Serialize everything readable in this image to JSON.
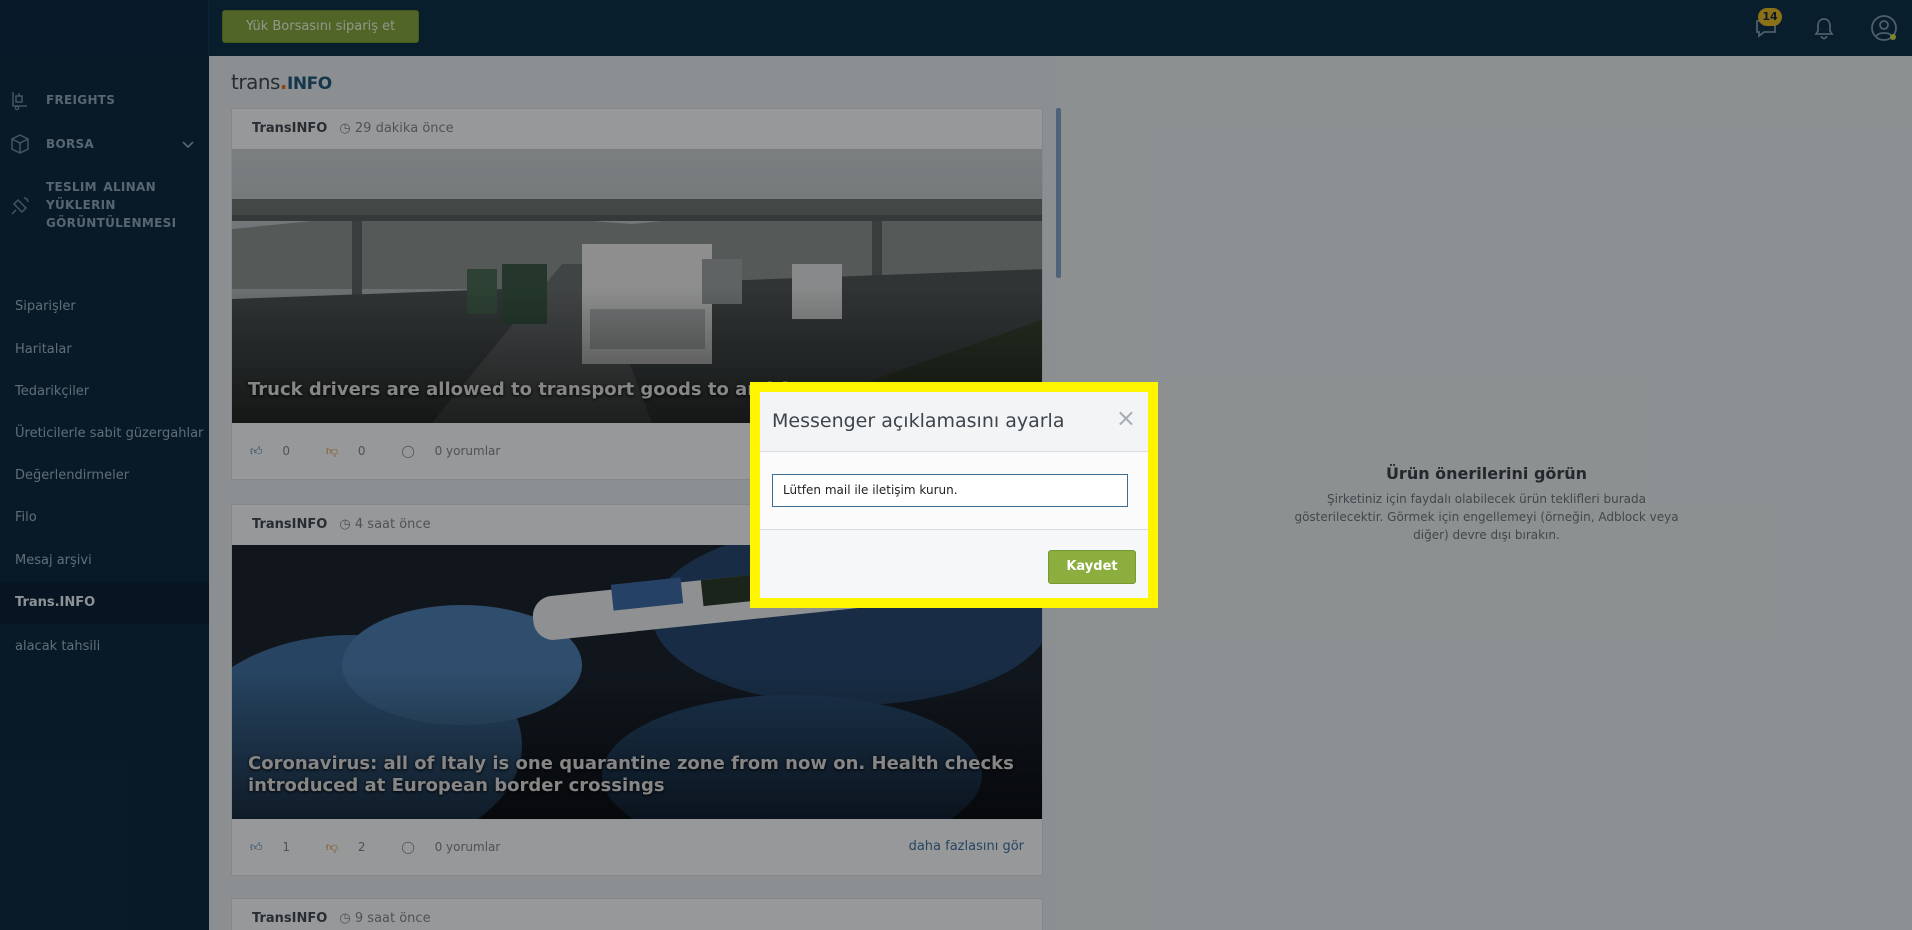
{
  "topbar": {
    "order_label": "Yük Borsasını sipariş et",
    "messages_count": "14",
    "icons": [
      "chat-icon",
      "bell-icon",
      "user-icon"
    ]
  },
  "sidebar": {
    "main": [
      {
        "label": "FREIGHTS",
        "icon": "freight-icon"
      },
      {
        "label": "BORSA",
        "icon": "box-icon"
      },
      {
        "label": "TESLIM ALINAN YÜKLERIN GÖRÜNTÜLENMESI",
        "icon": "satellite-icon"
      }
    ],
    "items": [
      {
        "label": "Siparişler"
      },
      {
        "label": "Haritalar"
      },
      {
        "label": "Tedarikçiler"
      },
      {
        "label": "Üreticilerle sabit güzergahlar"
      },
      {
        "label": "Değerlendirmeler"
      },
      {
        "label": "Filo"
      },
      {
        "label": "Mesaj arşivi"
      },
      {
        "label": "Trans.INFO"
      },
      {
        "label": "alacak tahsili"
      }
    ]
  },
  "news": {
    "logo_trans": "trans",
    "logo_dot": ".",
    "logo_info": "INFO",
    "cards": [
      {
        "source": "TransINFO",
        "time": "29 dakika önce",
        "title": "Truck drivers are allowed to transport goods to and from",
        "likes": "0",
        "dislikes": "0",
        "comments": "0 yorumlar"
      },
      {
        "source": "TransINFO",
        "time": "4 saat önce",
        "title": "Coronavirus: all of Italy is one quarantine zone from now on. Health checks introduced at European border crossings",
        "likes": "1",
        "dislikes": "2",
        "comments": "0 yorumlar",
        "more": "daha fazlasını gör"
      },
      {
        "source": "TransINFO",
        "time": "9 saat önce"
      }
    ]
  },
  "right_panel": {
    "title": "Ürün önerilerini görün",
    "text": "Şirketiniz için faydalı olabilecek ürün teklifleri burada gösterilecektir. Görmek için engellemeyi (örneğin, Adblock veya diğer) devre dışı bırakın."
  },
  "modal": {
    "title": "Messenger açıklamasını ayarla",
    "close": "×",
    "input_value": "Lütfen mail ile iletişim kurun.",
    "save_label": "Kaydet",
    "highlight_color": "#fff500"
  }
}
